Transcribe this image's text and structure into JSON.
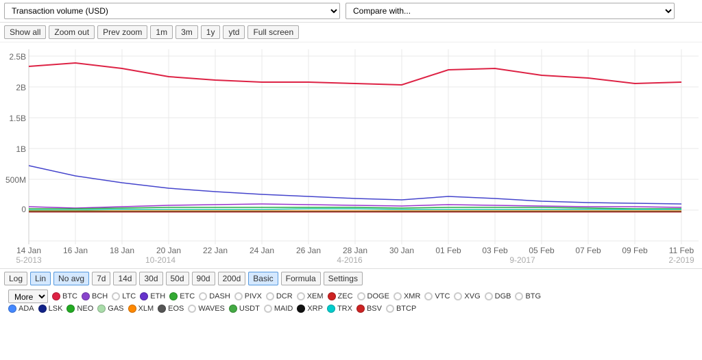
{
  "header": {
    "chart_title": "Transaction volume (USD)",
    "compare_placeholder": "Compare with..."
  },
  "controls": {
    "show_all": "Show all",
    "zoom_out": "Zoom out",
    "prev_zoom": "Prev zoom",
    "btn_1m": "1m",
    "btn_3m": "3m",
    "btn_1y": "1y",
    "btn_ytd": "ytd",
    "full_screen": "Full screen"
  },
  "chart": {
    "y_labels": [
      "2.5B",
      "2B",
      "1.5B",
      "1B",
      "500M",
      "0"
    ],
    "x_labels": [
      "14 Jan",
      "16 Jan",
      "18 Jan",
      "20 Jan",
      "22 Jan",
      "24 Jan",
      "26 Jan",
      "28 Jan",
      "30 Jan",
      "01 Feb",
      "03 Feb",
      "05 Feb",
      "07 Feb",
      "09 Feb",
      "11 Feb"
    ],
    "secondary_labels": [
      "5-2013",
      "10-2014",
      "4-2016",
      "9-2017",
      "2-2019"
    ]
  },
  "scale_buttons": [
    "Log",
    "Lin",
    "No avg",
    "7d",
    "14d",
    "30d",
    "50d",
    "90d",
    "200d",
    "Basic",
    "Formula",
    "Settings"
  ],
  "active_scale": "Lin",
  "active_avg": "No avg",
  "active_mode": "Basic",
  "more_label": "More",
  "legend": {
    "row1": [
      {
        "symbol": "BTC",
        "color": "#e05",
        "type": "dot"
      },
      {
        "symbol": "BCH",
        "color": "#8844cc",
        "type": "dot"
      },
      {
        "symbol": "LTC",
        "color": "#cccccc",
        "type": "outline"
      },
      {
        "symbol": "ETH",
        "color": "#6633cc",
        "type": "dot"
      },
      {
        "symbol": "ETC",
        "color": "#33aa33",
        "type": "dot"
      },
      {
        "symbol": "DASH",
        "color": "#aaaaaa",
        "type": "outline"
      },
      {
        "symbol": "PIVX",
        "color": "#dddddd",
        "type": "outline"
      },
      {
        "symbol": "DCR",
        "color": "#aaaaaa",
        "type": "outline"
      },
      {
        "symbol": "XEM",
        "color": "#dddddd",
        "type": "outline"
      },
      {
        "symbol": "ZEC",
        "color": "#cc2222",
        "type": "dot"
      },
      {
        "symbol": "DOGE",
        "color": "#dddddd",
        "type": "outline"
      },
      {
        "symbol": "XMR",
        "color": "#cccccc",
        "type": "outline"
      },
      {
        "symbol": "VTC",
        "color": "#dddddd",
        "type": "outline"
      },
      {
        "symbol": "XVG",
        "color": "#aaaaaa",
        "type": "outline"
      },
      {
        "symbol": "DGB",
        "color": "#dddddd",
        "type": "outline"
      },
      {
        "symbol": "BTG",
        "color": "#dddddd",
        "type": "outline"
      }
    ],
    "row2": [
      {
        "symbol": "ADA",
        "color": "#4488ff",
        "type": "dot"
      },
      {
        "symbol": "LSK",
        "color": "#112288",
        "type": "dot"
      },
      {
        "symbol": "NEO",
        "color": "#22aa22",
        "type": "dot"
      },
      {
        "symbol": "GAS",
        "color": "#aaddaa",
        "type": "dot"
      },
      {
        "symbol": "XLM",
        "color": "#ff8800",
        "type": "dot"
      },
      {
        "symbol": "EOS",
        "color": "#555555",
        "type": "dot"
      },
      {
        "symbol": "WAVES",
        "color": "#aaaaaa",
        "type": "outline"
      },
      {
        "symbol": "USDT",
        "color": "#44aa44",
        "type": "dot"
      },
      {
        "symbol": "MAID",
        "color": "#cccccc",
        "type": "outline"
      },
      {
        "symbol": "XRP",
        "color": "#111111",
        "type": "dot"
      },
      {
        "symbol": "TRX",
        "color": "#00cccc",
        "type": "dot"
      },
      {
        "symbol": "BSV",
        "color": "#cc2222",
        "type": "dot"
      },
      {
        "symbol": "BTCP",
        "color": "#cccccc",
        "type": "outline"
      }
    ]
  }
}
